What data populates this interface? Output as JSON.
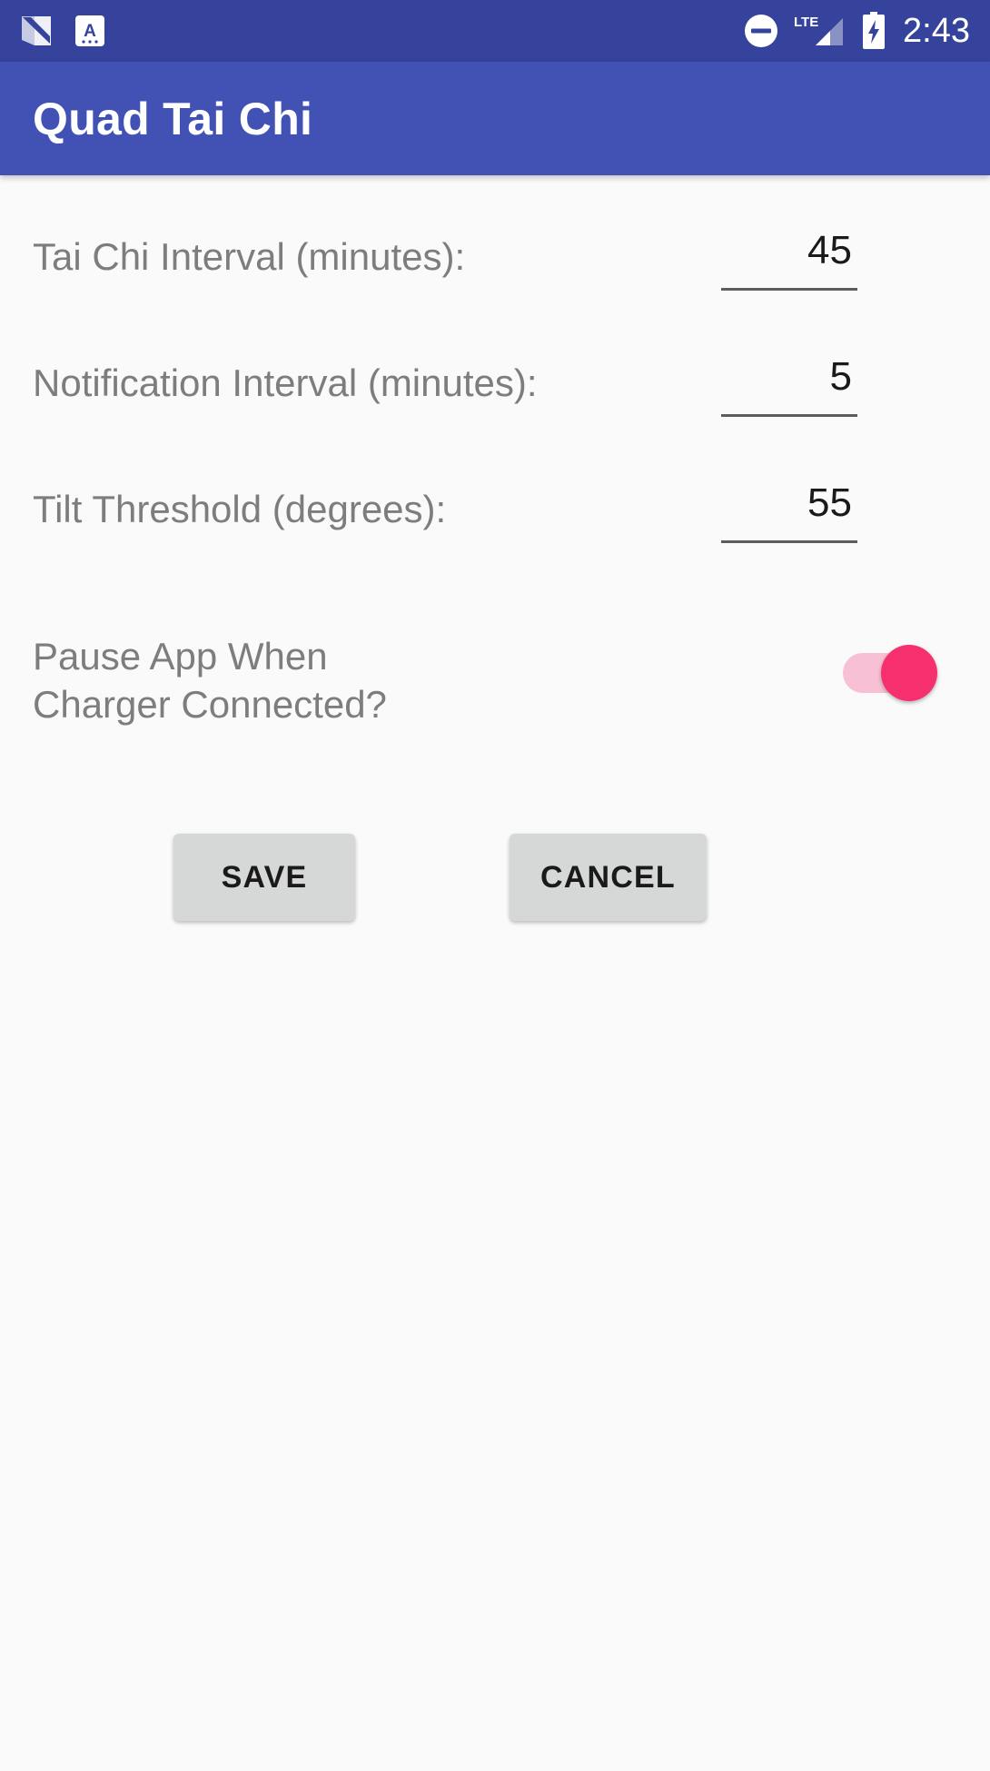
{
  "status_bar": {
    "background_color": "#35439C",
    "icons": [
      {
        "name": "android-nougat-icon",
        "label": "Android Nougat"
      },
      {
        "name": "app-notification-icon",
        "label": "A"
      },
      {
        "name": "do-not-disturb-icon",
        "label": "Do Not Disturb"
      },
      {
        "name": "lte-signal-icon",
        "label": "LTE"
      },
      {
        "name": "battery-charging-icon",
        "label": "Battery Charging"
      }
    ],
    "network_type": "LTE",
    "time": "2:43"
  },
  "app_bar": {
    "title": "Quad Tai Chi",
    "background_color": "#4152B4",
    "title_color": "#FFFFFF"
  },
  "settings": {
    "fields": [
      {
        "label": "Tai Chi Interval (minutes):",
        "value": "45",
        "name": "tai-chi-interval"
      },
      {
        "label": "Notification Interval (minutes):",
        "value": "5",
        "name": "notification-interval"
      },
      {
        "label": "Tilt Threshold (degrees):",
        "value": "55",
        "name": "tilt-threshold"
      }
    ],
    "toggle": {
      "label_line1": "Pause App When",
      "label_line2": "Charger Connected?",
      "state": "on",
      "thumb_color": "#F6306E",
      "track_color": "#F8C0D4"
    }
  },
  "actions": {
    "save_label": "SAVE",
    "cancel_label": "CANCEL",
    "button_color": "#D6D7D7"
  }
}
